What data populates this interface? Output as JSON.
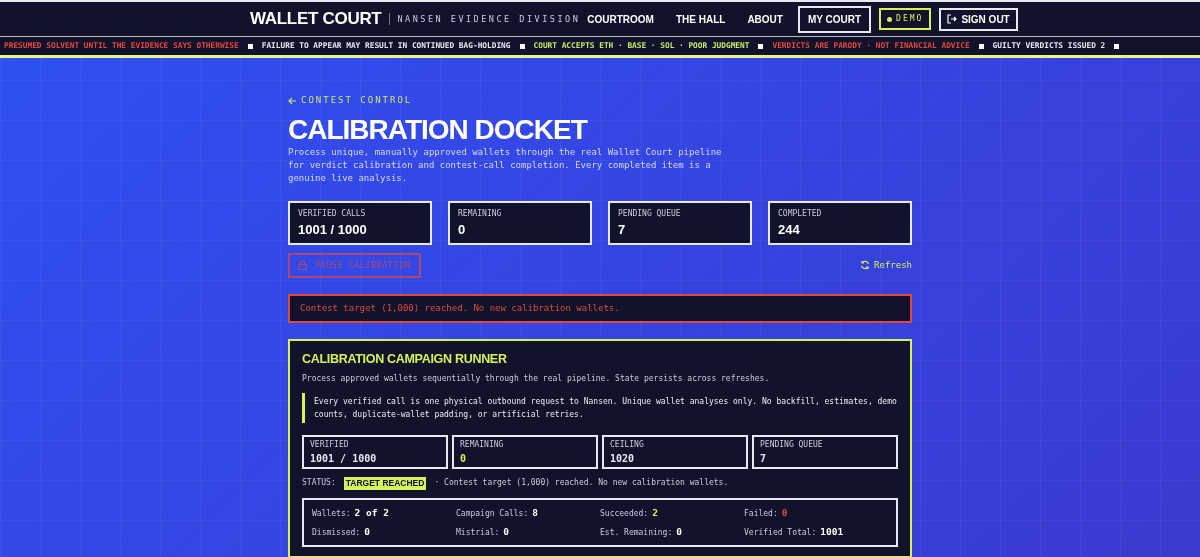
{
  "brand": {
    "title": "WALLET COURT",
    "subtitle": "NANSEN EVIDENCE DIVISION"
  },
  "nav": [
    {
      "label": "COURTROOM",
      "kind": "link"
    },
    {
      "label": "THE HALL",
      "kind": "link"
    },
    {
      "label": "ABOUT",
      "kind": "link"
    },
    {
      "label": "MY COURT",
      "kind": "outline"
    },
    {
      "label": "DEMO",
      "kind": "demo"
    },
    {
      "label": "SIGN OUT",
      "kind": "signout"
    }
  ],
  "ticker": [
    {
      "text": "PRESUMED SOLVENT UNTIL THE EVIDENCE SAYS OTHERWISE",
      "color": "#e0493f"
    },
    {
      "text": "FAILURE TO APPEAR MAY RESULT IN CONTINUED BAG-HOLDING",
      "color": "#e6e8f2"
    },
    {
      "text": "COURT ACCEPTS ETH · BASE · SOL · POOR JUDGMENT",
      "color": "#c8e86a"
    },
    {
      "text": "VERDICTS ARE PARODY · NOT FINANCIAL ADVICE",
      "color": "#e0493f"
    },
    {
      "text": "GUILTY VERDICTS ISSUED 2",
      "color": "#e6e8f2"
    }
  ],
  "back_link": "CONTEST CONTROL",
  "title": "CALIBRATION DOCKET",
  "description": "Process unique, manually approved wallets through the real Wallet Court pipeline for verdict calibration and contest-call completion. Every completed item is a genuine live analysis.",
  "stats": [
    {
      "label": "VERIFIED CALLS",
      "value": "1001 / 1000"
    },
    {
      "label": "REMAINING",
      "value": "0"
    },
    {
      "label": "PENDING QUEUE",
      "value": "7"
    },
    {
      "label": "COMPLETED",
      "value": "244"
    }
  ],
  "pause_button": {
    "label": "PAUSE CALIBRATION",
    "disabled": true
  },
  "refresh_button": "Refresh",
  "alert": "Contest target (1,000) reached. No new calibration wallets.",
  "runner": {
    "title": "CALIBRATION CAMPAIGN RUNNER",
    "subtitle": "Process approved wallets sequentially through the real pipeline. State persists across refreshes.",
    "note": "Every verified call is one physical outbound request to Nansen. Unique wallet analyses only. No backfill, estimates, demo counts, duplicate-wallet padding, or artificial retries.",
    "metrics": [
      {
        "label": "VERIFIED",
        "value": "1001 / 1000",
        "color": "#e6e8f2"
      },
      {
        "label": "REMAINING",
        "value": "0",
        "color": "#d4f25a"
      },
      {
        "label": "CEILING",
        "value": "1020",
        "color": "#e6e8f2"
      },
      {
        "label": "PENDING QUEUE",
        "value": "7",
        "color": "#e6e8f2"
      }
    ],
    "status_label": "STATUS:",
    "status_badge": "TARGET REACHED",
    "status_text": "· Contest target (1,000) reached. No new calibration wallets.",
    "summary": [
      {
        "label": "Wallets:",
        "value": "2 of 2",
        "color": "#ffffff"
      },
      {
        "label": "Campaign Calls:",
        "value": "8",
        "color": "#ffffff"
      },
      {
        "label": "Succeeded:",
        "value": "2",
        "color": "#d4f25a"
      },
      {
        "label": "Failed:",
        "value": "0",
        "color": "#e0493f"
      },
      {
        "label": "Dismissed:",
        "value": "0",
        "color": "#ffffff"
      },
      {
        "label": "Mistrial:",
        "value": "0",
        "color": "#ffffff"
      },
      {
        "label": "Est. Remaining:",
        "value": "0",
        "color": "#ffffff"
      },
      {
        "label": "Verified Total:",
        "value": "1001",
        "color": "#ffffff"
      }
    ]
  }
}
